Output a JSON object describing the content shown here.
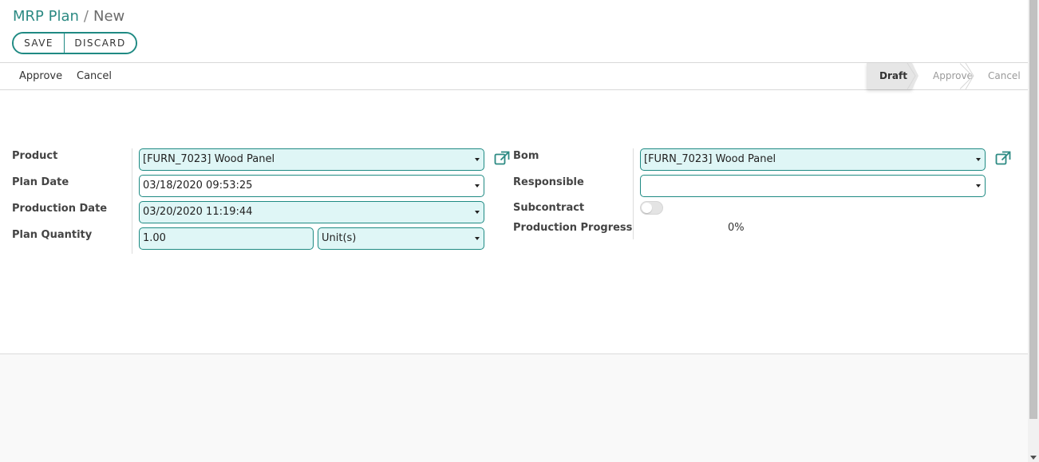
{
  "breadcrumb": {
    "parent": "MRP Plan",
    "separator": "/",
    "current": "New"
  },
  "buttons": {
    "save": "SAVE",
    "discard": "DISCARD"
  },
  "actions": {
    "approve": "Approve",
    "cancel": "Cancel"
  },
  "stages": [
    {
      "label": "Draft",
      "active": true
    },
    {
      "label": "Approve",
      "active": false
    },
    {
      "label": "Cancel",
      "active": false
    }
  ],
  "form": {
    "product": {
      "label": "Product",
      "value": "[FURN_7023] Wood Panel"
    },
    "plan_date": {
      "label": "Plan Date",
      "value": "03/18/2020 09:53:25"
    },
    "production_date": {
      "label": "Production Date",
      "value": "03/20/2020 11:19:44"
    },
    "plan_quantity": {
      "label": "Plan Quantity",
      "value": "1.00",
      "uom": "Unit(s)"
    },
    "bom": {
      "label": "Bom",
      "value": "[FURN_7023] Wood Panel"
    },
    "responsible": {
      "label": "Responsible",
      "value": ""
    },
    "subcontract": {
      "label": "Subcontract",
      "checked": false
    },
    "production_progress": {
      "label": "Production Progress",
      "value": "0%"
    }
  },
  "colors": {
    "accent": "#1f8a83",
    "field_bg": "#dff6f6",
    "link": "#2c8a83"
  },
  "icons": {
    "external_link": "external-link-icon",
    "dropdown": "caret-down-icon"
  }
}
